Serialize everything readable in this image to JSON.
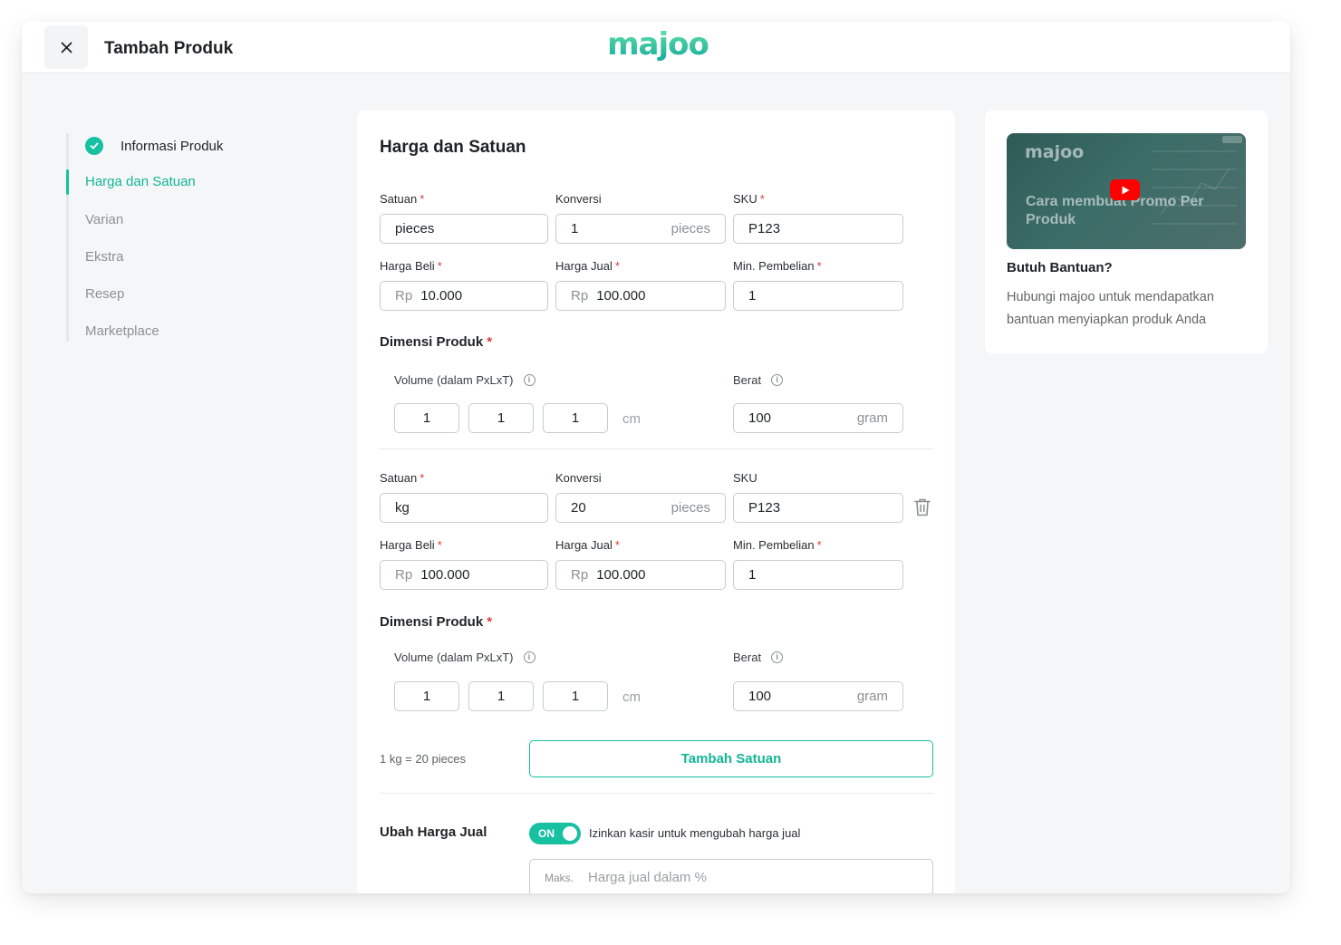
{
  "header": {
    "title": "Tambah Produk",
    "logo_text": "majoo"
  },
  "stepper": {
    "items": [
      {
        "label": "Informasi Produk",
        "state": "done"
      },
      {
        "label": "Harga dan Satuan",
        "state": "active"
      },
      {
        "label": "Varian",
        "state": "pending"
      },
      {
        "label": "Ekstra",
        "state": "pending"
      },
      {
        "label": "Resep",
        "state": "pending"
      },
      {
        "label": "Marketplace",
        "state": "pending"
      }
    ]
  },
  "form": {
    "section_title": "Harga dan Satuan",
    "units": [
      {
        "satuan_label": "Satuan",
        "satuan_value": "pieces",
        "konversi_label": "Konversi",
        "konversi_value": "1",
        "konversi_unit": "pieces",
        "sku_label": "SKU",
        "sku_value": "P123",
        "harga_beli_label": "Harga Beli",
        "harga_beli_prefix": "Rp",
        "harga_beli_value": "10.000",
        "harga_jual_label": "Harga Jual",
        "harga_jual_prefix": "Rp",
        "harga_jual_value": "100.000",
        "min_pembelian_label": "Min. Pembelian",
        "min_pembelian_value": "1",
        "dimensi_label": "Dimensi Produk",
        "volume_label": "Volume (dalam PxLxT)",
        "volume_p": "1",
        "volume_l": "1",
        "volume_t": "1",
        "volume_unit": "cm",
        "berat_label": "Berat",
        "berat_value": "100",
        "berat_unit": "gram"
      },
      {
        "satuan_label": "Satuan",
        "satuan_value": "kg",
        "konversi_label": "Konversi",
        "konversi_value": "20",
        "konversi_unit": "pieces",
        "sku_label": "SKU",
        "sku_value": "P123",
        "harga_beli_label": "Harga Beli",
        "harga_beli_prefix": "Rp",
        "harga_beli_value": "100.000",
        "harga_jual_label": "Harga Jual",
        "harga_jual_prefix": "Rp",
        "harga_jual_value": "100.000",
        "min_pembelian_label": "Min. Pembelian",
        "min_pembelian_value": "1",
        "dimensi_label": "Dimensi Produk",
        "volume_label": "Volume (dalam PxLxT)",
        "volume_p": "1",
        "volume_l": "1",
        "volume_t": "1",
        "volume_unit": "cm",
        "berat_label": "Berat",
        "berat_value": "100",
        "berat_unit": "gram"
      }
    ],
    "conversion_note": "1 kg = 20 pieces",
    "add_unit_button": "Tambah Satuan",
    "ubah_harga_label": "Ubah Harga Jual",
    "toggle_state": "ON",
    "toggle_desc": "Izinkan kasir untuk mengubah harga jual",
    "maks_prefix": "Maks.",
    "maks_placeholder": "Harga jual dalam %"
  },
  "help": {
    "video_logo": "majoo",
    "video_title": "Cara membuat Promo Per Produk",
    "title": "Butuh Bantuan?",
    "description": "Hubungi majoo untuk mendapatkan bantuan menyiapkan produk Anda"
  },
  "colors": {
    "accent": "#16c0a0",
    "required": "#e23a3a",
    "youtube": "#ff0000"
  }
}
